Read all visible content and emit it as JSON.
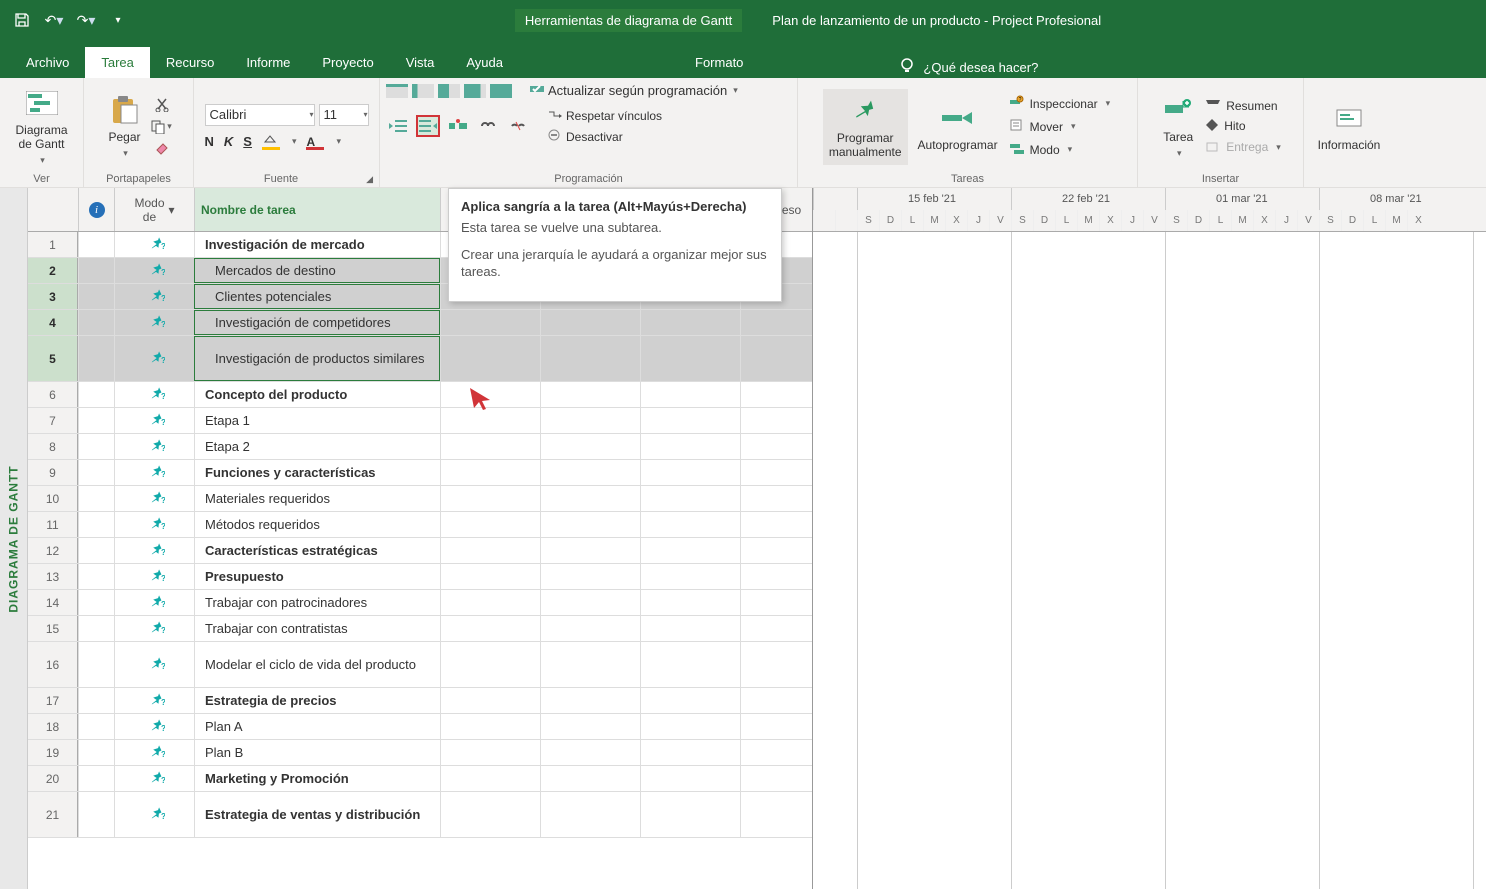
{
  "titlebar": {
    "context_title": "Herramientas de diagrama de Gantt",
    "doc_title": "Plan de lanzamiento de un producto  -  Project Profesional"
  },
  "tabs": {
    "archivo": "Archivo",
    "tarea": "Tarea",
    "recurso": "Recurso",
    "informe": "Informe",
    "proyecto": "Proyecto",
    "vista": "Vista",
    "ayuda": "Ayuda",
    "formato": "Formato",
    "tellme": "¿Qué desea hacer?"
  },
  "ribbon": {
    "ver": {
      "label": "Ver",
      "gantt": "Diagrama\nde Gantt"
    },
    "portapapeles": {
      "label": "Portapapeles",
      "pegar": "Pegar"
    },
    "fuente": {
      "label": "Fuente",
      "font_name": "Calibri",
      "font_size": "11"
    },
    "programacion": {
      "label": "Programación",
      "actualizar": "Actualizar según programación",
      "respetar": "Respetar vínculos",
      "desactivar": "Desactivar"
    },
    "tareas": {
      "label": "Tareas",
      "manual": "Programar\nmanualmente",
      "auto": "Autoprogramar",
      "inspeccionar": "Inspeccionar",
      "mover": "Mover",
      "modo": "Modo"
    },
    "insertar": {
      "label": "Insertar",
      "tarea": "Tarea",
      "resumen": "Resumen",
      "hito": "Hito",
      "entrega": "Entrega"
    },
    "informacion": {
      "info": "Información"
    }
  },
  "sheet": {
    "headers": {
      "info": "",
      "modo": "Modo\nde",
      "nombre": "Nombre de tarea",
      "predeceso": "redeceso"
    },
    "rows": [
      {
        "n": "1",
        "name": "Investigación de mercado",
        "bold": true,
        "sel": false
      },
      {
        "n": "2",
        "name": "Mercados de destino",
        "bold": false,
        "sel": true,
        "indent": true
      },
      {
        "n": "3",
        "name": "Clientes potenciales",
        "bold": false,
        "sel": true,
        "indent": true
      },
      {
        "n": "4",
        "name": "Investigación de competidores",
        "bold": false,
        "sel": true,
        "indent": true
      },
      {
        "n": "5",
        "name": "Investigación de productos similares",
        "bold": false,
        "sel": true,
        "double": true,
        "indent": true
      },
      {
        "n": "6",
        "name": "Concepto del producto",
        "bold": true
      },
      {
        "n": "7",
        "name": "Etapa 1",
        "bold": false
      },
      {
        "n": "8",
        "name": "Etapa 2",
        "bold": false
      },
      {
        "n": "9",
        "name": "Funciones y características",
        "bold": true
      },
      {
        "n": "10",
        "name": "Materiales requeridos",
        "bold": false
      },
      {
        "n": "11",
        "name": "Métodos requeridos",
        "bold": false
      },
      {
        "n": "12",
        "name": "Características estratégicas",
        "bold": true
      },
      {
        "n": "13",
        "name": "Presupuesto",
        "bold": true
      },
      {
        "n": "14",
        "name": "Trabajar con patrocinadores",
        "bold": false
      },
      {
        "n": "15",
        "name": "Trabajar con contratistas",
        "bold": false
      },
      {
        "n": "16",
        "name": "Modelar el ciclo de vida del producto",
        "bold": false,
        "double": true
      },
      {
        "n": "17",
        "name": "Estrategia de precios",
        "bold": true
      },
      {
        "n": "18",
        "name": "Plan A",
        "bold": false
      },
      {
        "n": "19",
        "name": "Plan B",
        "bold": false
      },
      {
        "n": "20",
        "name": "Marketing y Promoción",
        "bold": true
      },
      {
        "n": "21",
        "name": "Estrategia de ventas y distribución",
        "bold": true,
        "double": true
      }
    ]
  },
  "gantt": {
    "weeks": [
      "15 feb '21",
      "22 feb '21",
      "01 mar '21",
      "08 mar '21"
    ],
    "days": [
      "S",
      "D",
      "L",
      "M",
      "X",
      "J",
      "V",
      "S",
      "D",
      "L",
      "M",
      "X",
      "J",
      "V",
      "S",
      "D",
      "L",
      "M",
      "X",
      "J",
      "V",
      "S",
      "D",
      "L",
      "M",
      "X"
    ]
  },
  "tooltip": {
    "title": "Aplica sangría a la tarea (Alt+Mayús+Derecha)",
    "line1": "Esta tarea se vuelve una subtarea.",
    "line2": "Crear una jerarquía le ayudará a organizar mejor sus tareas."
  },
  "sidebar": {
    "label": "DIAGRAMA DE GANTT"
  }
}
